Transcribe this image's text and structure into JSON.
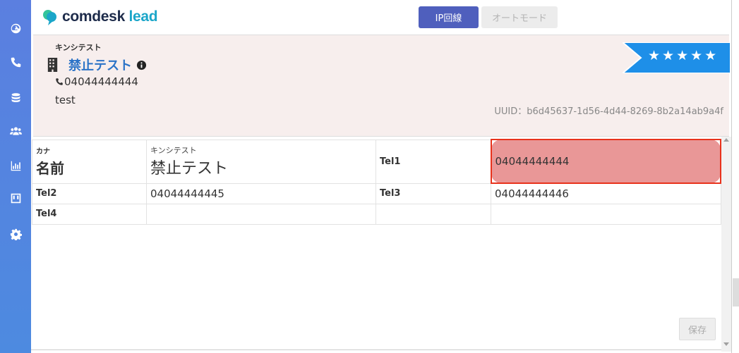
{
  "app": {
    "logo_main": "comdesk",
    "logo_accent": "lead"
  },
  "sidebar": {
    "items": [
      {
        "icon": "dashboard-icon"
      },
      {
        "icon": "phone-icon"
      },
      {
        "icon": "database-icon"
      },
      {
        "icon": "users-icon"
      },
      {
        "icon": "bar-chart-icon"
      },
      {
        "icon": "board-icon"
      },
      {
        "icon": "gear-icon"
      }
    ]
  },
  "toolbar": {
    "ip_line_label": "IP回線",
    "auto_mode_label": "オートモード"
  },
  "header": {
    "kana": "キンシテスト",
    "company_name": "禁止テスト",
    "phone": "04044444444",
    "note": "test",
    "uuid": "UUID：b6d45637-1d56-4d44-8269-8b2a14ab9a4f",
    "rating_stars": "★★★★★",
    "rating_value": 5,
    "rating_color": "#1e8fe8"
  },
  "details": {
    "kana_label": "カナ",
    "name_label": "名前",
    "kana_value": "キンシテスト",
    "name_value": "禁止テスト",
    "tel1_label": "Tel1",
    "tel1_value": "04044444444",
    "tel2_label": "Tel2",
    "tel2_value": "04044444445",
    "tel3_label": "Tel3",
    "tel3_value": "04044444446",
    "tel4_label": "Tel4",
    "tel4_value": ""
  },
  "footer": {
    "save_label": "保存"
  },
  "colors": {
    "sidebar": "#5b7fe0",
    "primary_button": "#4f5fbd",
    "company_link": "#2b73c7",
    "highlight_fill": "#e99797",
    "highlight_border": "#e8321c"
  }
}
